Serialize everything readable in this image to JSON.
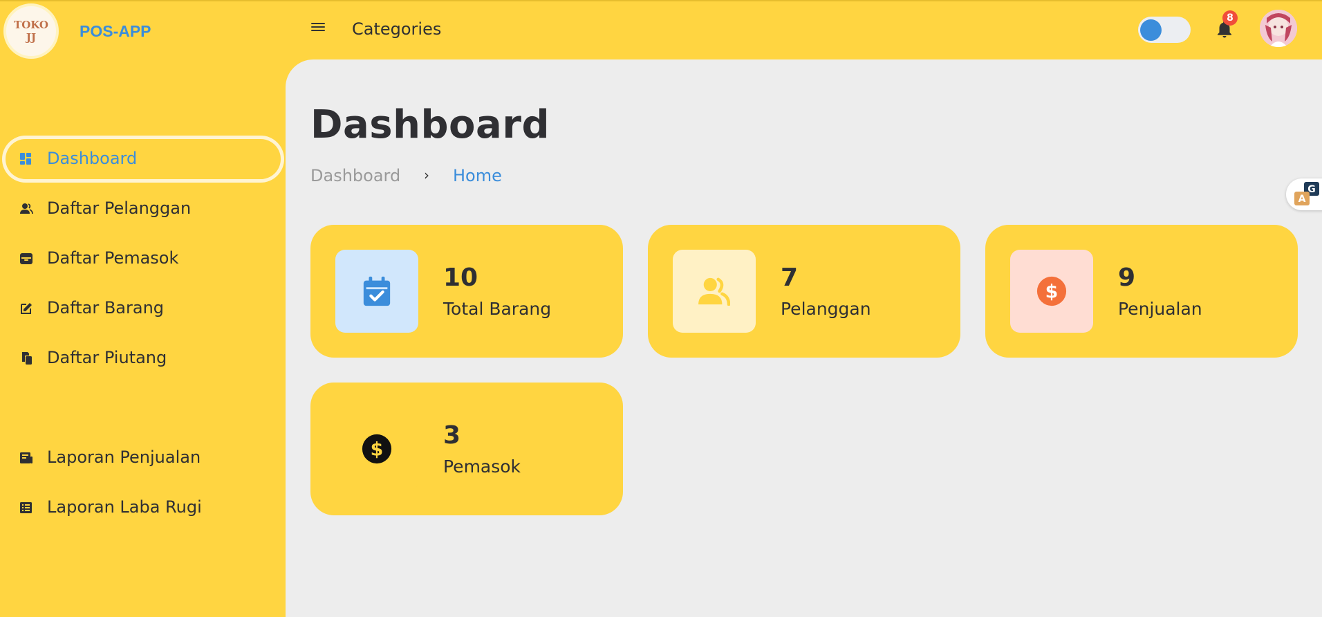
{
  "app": {
    "logo_line1": "TOKO",
    "logo_line2": "JJ",
    "brand": "POS-APP"
  },
  "header": {
    "title": "Categories",
    "notification_count": "8",
    "theme_toggle_on": true
  },
  "sidebar": {
    "items": [
      {
        "label": "Dashboard",
        "icon": "dashboard-icon",
        "active": true
      },
      {
        "label": "Daftar Pelanggan",
        "icon": "users-icon"
      },
      {
        "label": "Daftar Pemasok",
        "icon": "archive-icon"
      },
      {
        "label": "Daftar Barang",
        "icon": "edit-icon"
      },
      {
        "label": "Daftar Piutang",
        "icon": "copy-icon"
      },
      {
        "label": "Laporan Penjualan",
        "icon": "receipt-icon"
      },
      {
        "label": "Laporan Laba Rugi",
        "icon": "list-icon"
      }
    ]
  },
  "main": {
    "page_title": "Dashboard",
    "breadcrumb": {
      "root": "Dashboard",
      "separator": "›",
      "current": "Home"
    },
    "cards": [
      {
        "value": "10",
        "label": "Total Barang",
        "icon": "calendar-check-icon",
        "icon_bg": "#D1E7FC",
        "icon_color": "#3b8ddb"
      },
      {
        "value": "7",
        "label": "Pelanggan",
        "icon": "users-icon",
        "icon_bg": "#FFF1C5",
        "icon_color": "#FFD541"
      },
      {
        "value": "9",
        "label": "Penjualan",
        "icon": "dollar-icon",
        "icon_bg": "#FFDDD3",
        "icon_color": "#F4703A"
      },
      {
        "value": "3",
        "label": "Pemasok",
        "icon": "dollar-icon",
        "icon_bg": "#FFD541",
        "icon_color": "#111111"
      }
    ]
  },
  "colors": {
    "primary_yellow": "#FFD541",
    "accent_blue": "#3b8ddb",
    "content_bg": "#EDEDED",
    "badge_red": "#F04E3A"
  }
}
